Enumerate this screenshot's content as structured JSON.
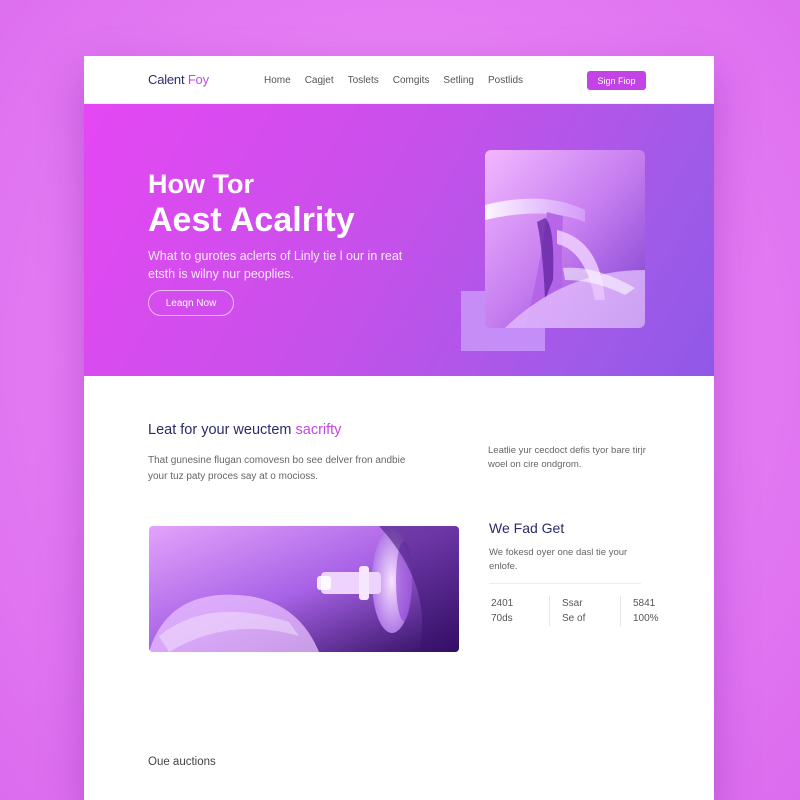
{
  "header": {
    "brand_part1": "Calent",
    "brand_part2": "Foy",
    "nav": [
      "Home",
      "Cagjet",
      "Toslets",
      "Comgits",
      "Setling",
      "Postlids"
    ],
    "signup_label": "Sign Fiop"
  },
  "hero": {
    "title_line1": "How Tor",
    "title_line2": "Aest Acalrity",
    "description": "What to gurotes aclerts of Linly tie l our in reat etsth is wilny nur peoplies.",
    "cta_label": "Leaqn Now"
  },
  "section": {
    "title_main": "Leat for your weuctem",
    "title_highlight": "sacrifty",
    "text": "That gunesine flugan comovesn bo see delver fron andbie your tuz paty proces say at o mocioss.",
    "side_text": "Leatlie yur cecdoct defis tyor bare tirjr woel on cire ondgrom."
  },
  "feature": {
    "title": "We Fad Get",
    "text": "We fokesd oyer one dasl tie your enlofe.",
    "stats": [
      {
        "top": "2401",
        "bottom": "70ds"
      },
      {
        "top": "Ssar",
        "bottom": "Se of"
      },
      {
        "top": "5841",
        "bottom": "100%"
      }
    ]
  },
  "footer": {
    "title": "Oue auctions"
  },
  "colors": {
    "background": "#e57cf4",
    "accent": "#c443e6",
    "heading": "#2c2a6a",
    "hero_start": "#e547f3",
    "hero_end": "#9058e8"
  }
}
